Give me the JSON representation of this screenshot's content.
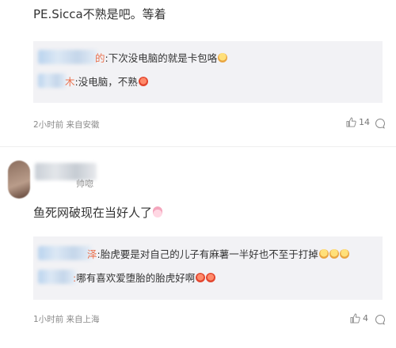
{
  "comments": [
    {
      "text": "PE.Sicca不熟是吧。等着",
      "replies": [
        {
          "name_tail": "的",
          "text": ":下次没电脑的就是卡包咯",
          "emojis": [
            "cry"
          ]
        },
        {
          "name_tail": "木",
          "text": ":没电脑，不熟",
          "emojis": [
            "angry"
          ]
        }
      ],
      "meta": "2小时前 来自安徽",
      "likes": "14"
    },
    {
      "username_tail": "帅唿",
      "text": "鱼死网破现在当好人了",
      "text_emoji": "bunny",
      "replies": [
        {
          "name_tail": "泽",
          "text": ":胎虎要是对自己的儿子有麻薯一半好也不至于打掉",
          "emojis": [
            "cry",
            "cry",
            "cry"
          ]
        },
        {
          "name_tail": ":",
          "text": "哪有喜欢爱堕胎的胎虎好啊",
          "emojis": [
            "angry",
            "angry"
          ]
        }
      ],
      "meta": "1小时前 来自上海",
      "likes": "4"
    }
  ],
  "icons": {
    "like": "thumbs-up-icon",
    "reply": "comment-bubble-icon"
  },
  "colors": {
    "name_accent": "#eb7350",
    "quote_bg": "#f2f2f5",
    "meta": "#8a8a8a"
  }
}
